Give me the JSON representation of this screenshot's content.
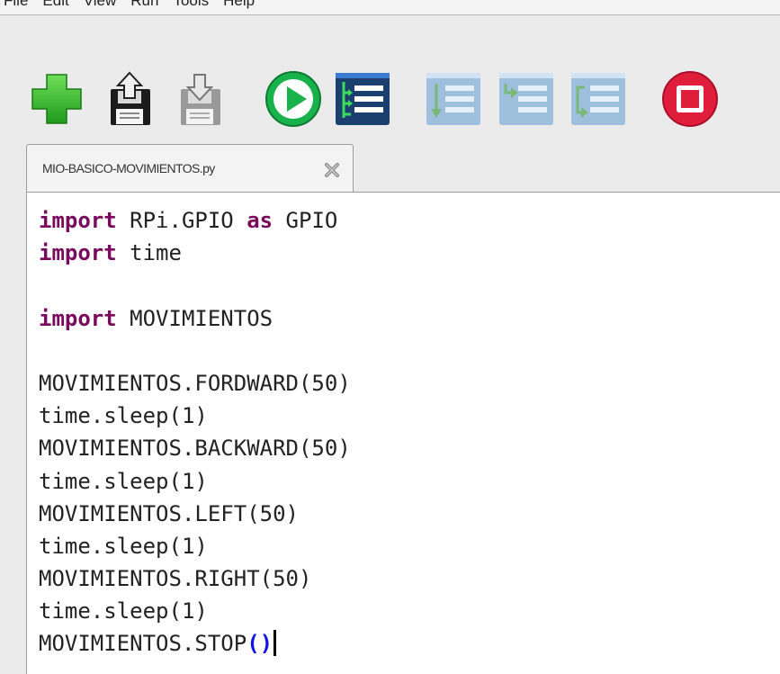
{
  "menubar": {
    "items": [
      "File",
      "Edit",
      "View",
      "Run",
      "Tools",
      "Help"
    ]
  },
  "toolbar": {
    "buttons": [
      {
        "name": "new-file-button",
        "icon": "plus-icon"
      },
      {
        "name": "open-file-button",
        "icon": "floppy-upload-icon"
      },
      {
        "name": "save-file-button",
        "icon": "floppy-save-icon"
      },
      {
        "name": "run-button",
        "icon": "play-icon"
      },
      {
        "name": "debug-button",
        "icon": "debug-icon"
      },
      {
        "name": "step-over-button",
        "icon": "step-over-icon"
      },
      {
        "name": "step-into-button",
        "icon": "step-into-icon"
      },
      {
        "name": "step-out-button",
        "icon": "step-out-icon"
      },
      {
        "name": "stop-button",
        "icon": "stop-icon"
      }
    ]
  },
  "tab": {
    "filename": "MIO-BASICO-MOVIMIENTOS.py"
  },
  "code": {
    "lines": [
      [
        {
          "t": "import",
          "k": "kw"
        },
        {
          "t": " RPi.GPIO "
        },
        {
          "t": "as",
          "k": "kw"
        },
        {
          "t": " GPIO"
        }
      ],
      [
        {
          "t": "import",
          "k": "kw"
        },
        {
          "t": " time"
        }
      ],
      [],
      [
        {
          "t": "import",
          "k": "kw"
        },
        {
          "t": " MOVIMIENTOS"
        }
      ],
      [],
      [
        {
          "t": "MOVIMIENTOS.FORDWARD(50)"
        }
      ],
      [
        {
          "t": "time.sleep(1)"
        }
      ],
      [
        {
          "t": "MOVIMIENTOS.BACKWARD(50)"
        }
      ],
      [
        {
          "t": "time.sleep(1)"
        }
      ],
      [
        {
          "t": "MOVIMIENTOS.LEFT(50)"
        }
      ],
      [
        {
          "t": "time.sleep(1)"
        }
      ],
      [
        {
          "t": "MOVIMIENTOS.RIGHT(50)"
        }
      ],
      [
        {
          "t": "time.sleep(1)"
        }
      ],
      [
        {
          "t": "MOVIMIENTOS.STOP"
        },
        {
          "t": "()",
          "k": "par"
        }
      ]
    ]
  },
  "colors": {
    "keyword": "#7a0a5c",
    "bracket_match": "#1212e8",
    "run_green": "#18b24a",
    "stop_red": "#e01e3c",
    "new_green": "#3dbb2f"
  }
}
